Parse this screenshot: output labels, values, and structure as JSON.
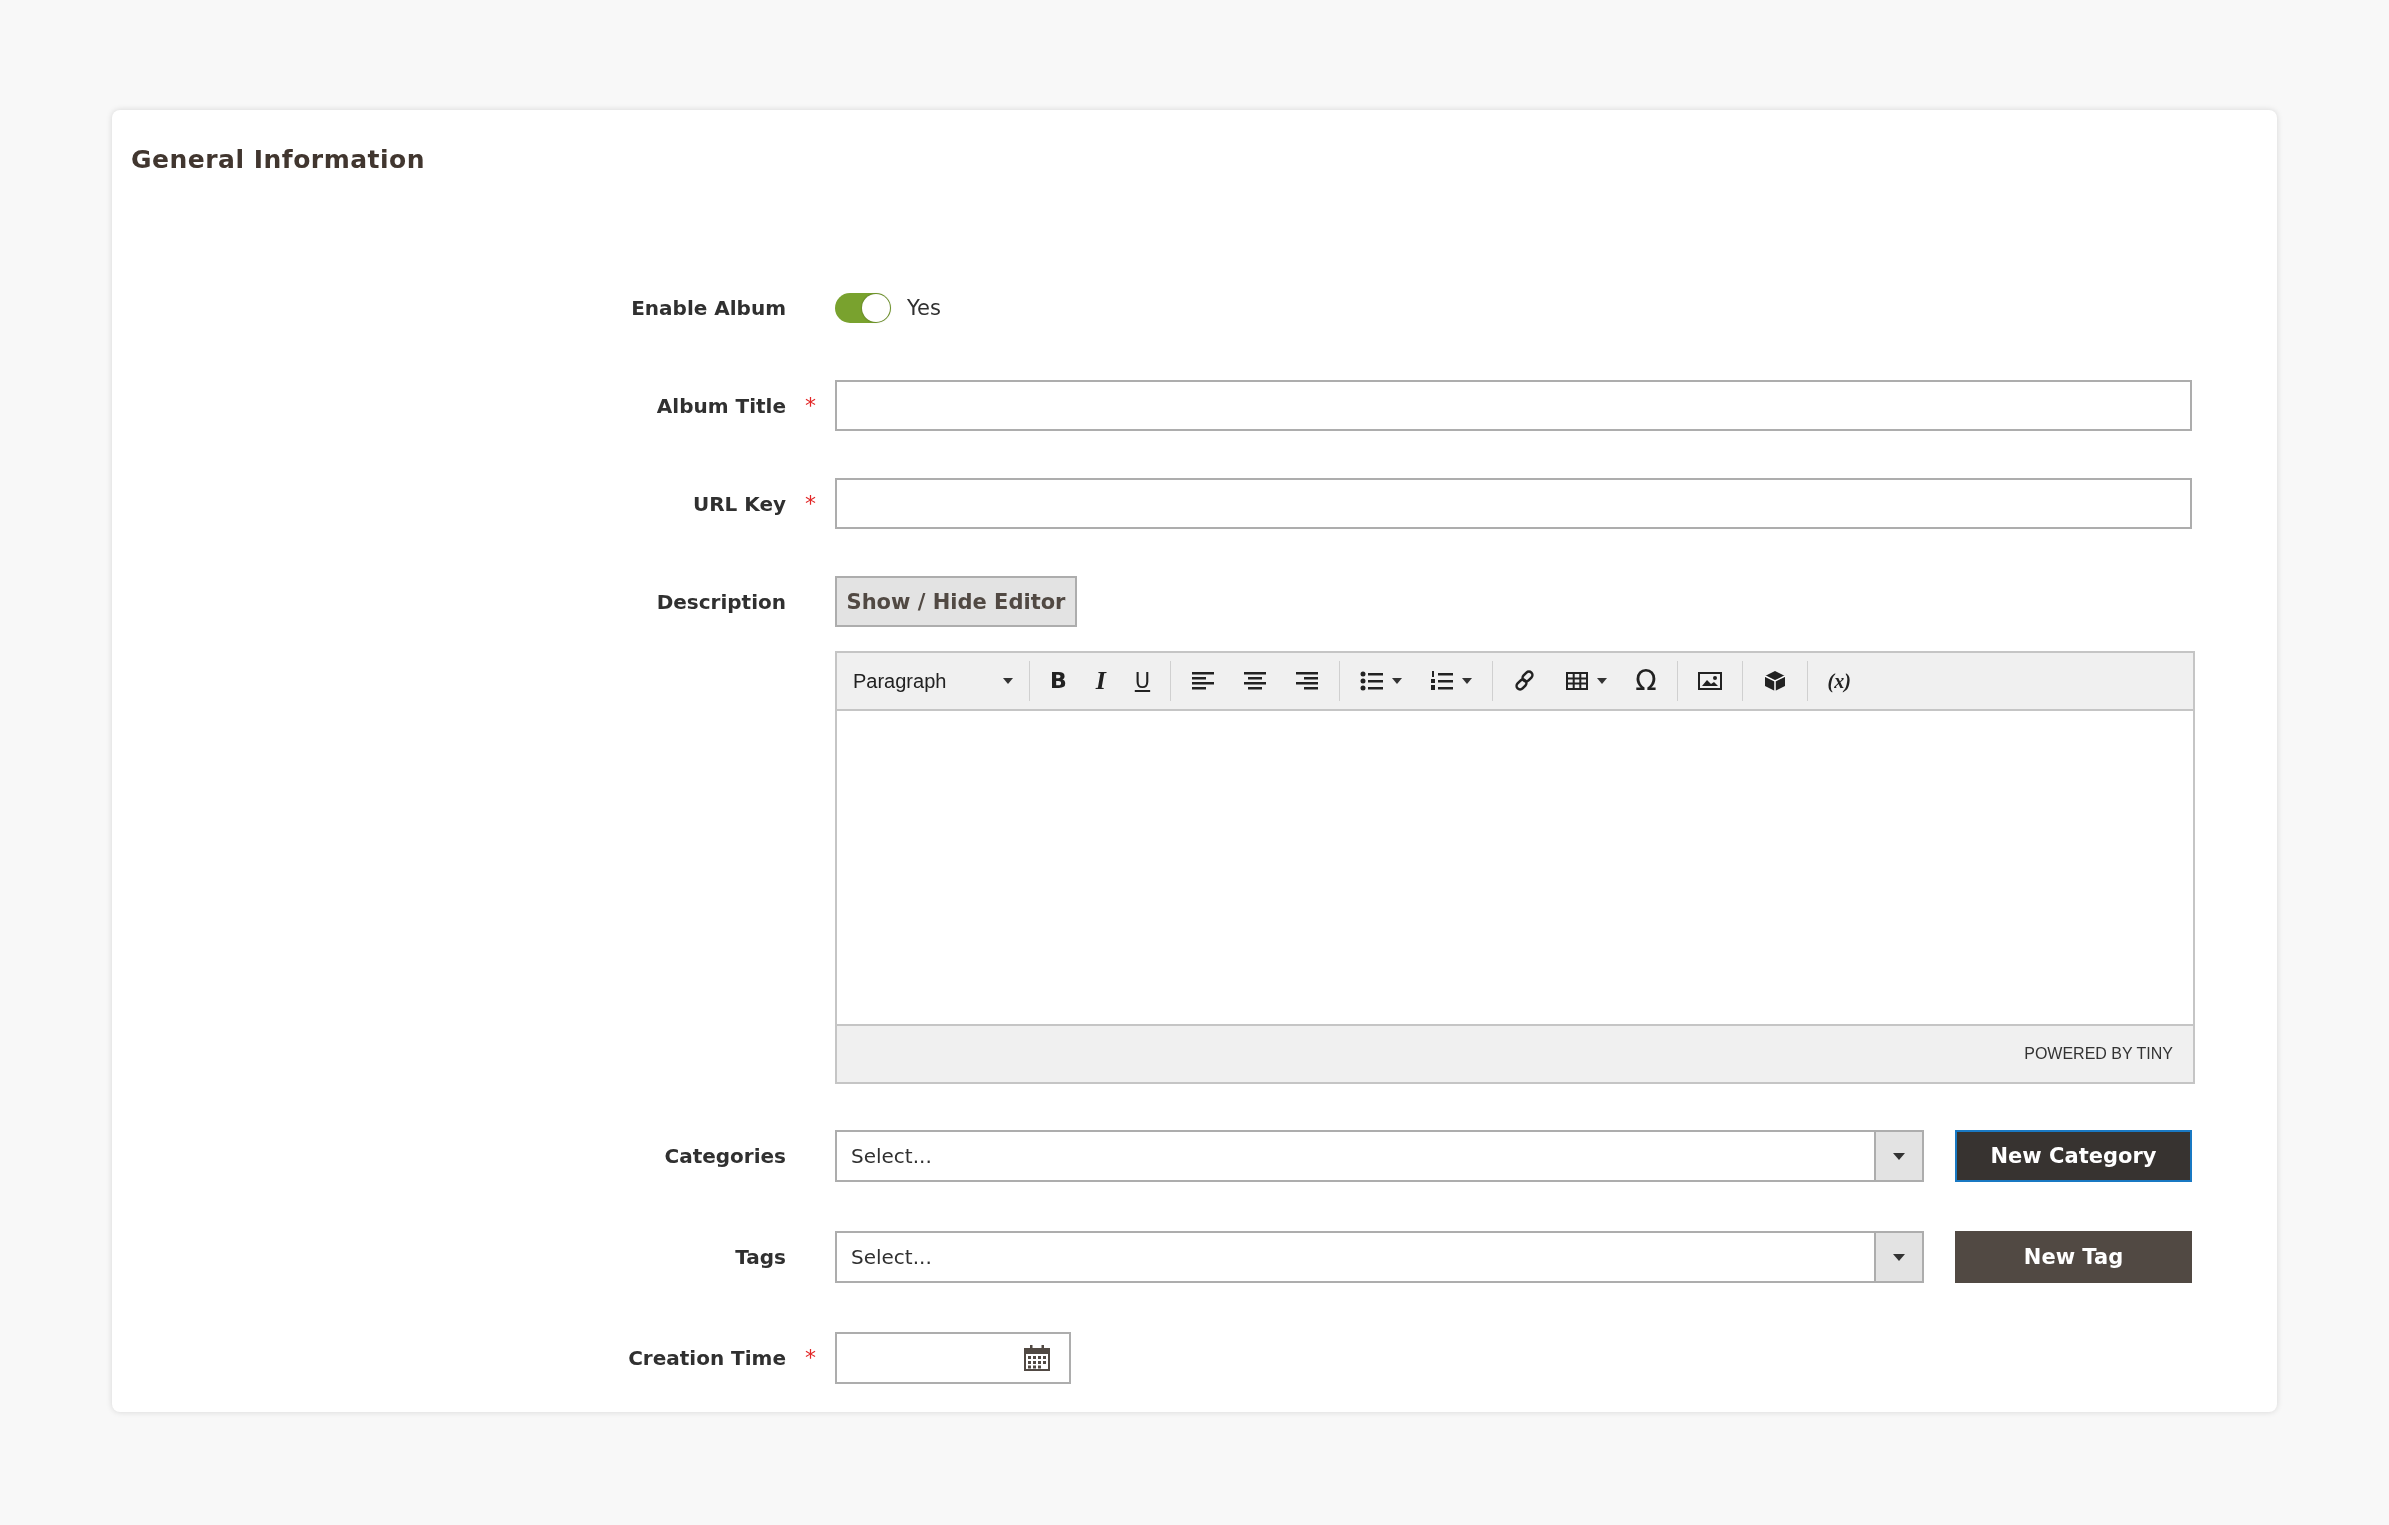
{
  "section": {
    "title": "General Information"
  },
  "fields": [
    {
      "kind": "toggle",
      "label": "Enable Album",
      "on": true,
      "value_label": "Yes"
    },
    {
      "kind": "text",
      "label": "Album Title",
      "required_mark": "*"
    },
    {
      "kind": "text",
      "label": "URL Key",
      "required_mark": "*"
    },
    {
      "kind": "editor",
      "label": "Description",
      "toggle_button": "Show / Hide Editor",
      "format": "Paragraph",
      "footer": "POWERED BY TINY",
      "toolbar": [
        [
          {
            "kind": "bold",
            "label": "B"
          },
          {
            "kind": "italic",
            "label": "I"
          },
          {
            "kind": "underline",
            "label": "U"
          }
        ],
        [
          {
            "kind": "align-left"
          },
          {
            "kind": "align-center"
          },
          {
            "kind": "align-right"
          }
        ],
        [
          {
            "kind": "bullet-list",
            "has_menu": true
          },
          {
            "kind": "numbered-list",
            "has_menu": true
          }
        ],
        [
          {
            "kind": "link"
          },
          {
            "kind": "table",
            "has_menu": true
          },
          {
            "kind": "glyph",
            "label": "Ω"
          }
        ],
        [
          {
            "kind": "image"
          }
        ],
        [
          {
            "kind": "widget"
          }
        ],
        [
          {
            "kind": "variable",
            "label": "(x)"
          }
        ]
      ]
    },
    {
      "kind": "select",
      "label": "Categories",
      "placeholder": "Select...",
      "button": "New Category",
      "focused": true
    },
    {
      "kind": "select",
      "label": "Tags",
      "placeholder": "Select...",
      "button": "New Tag",
      "focused": false
    },
    {
      "kind": "date",
      "label": "Creation Time",
      "required_mark": "*"
    }
  ]
}
